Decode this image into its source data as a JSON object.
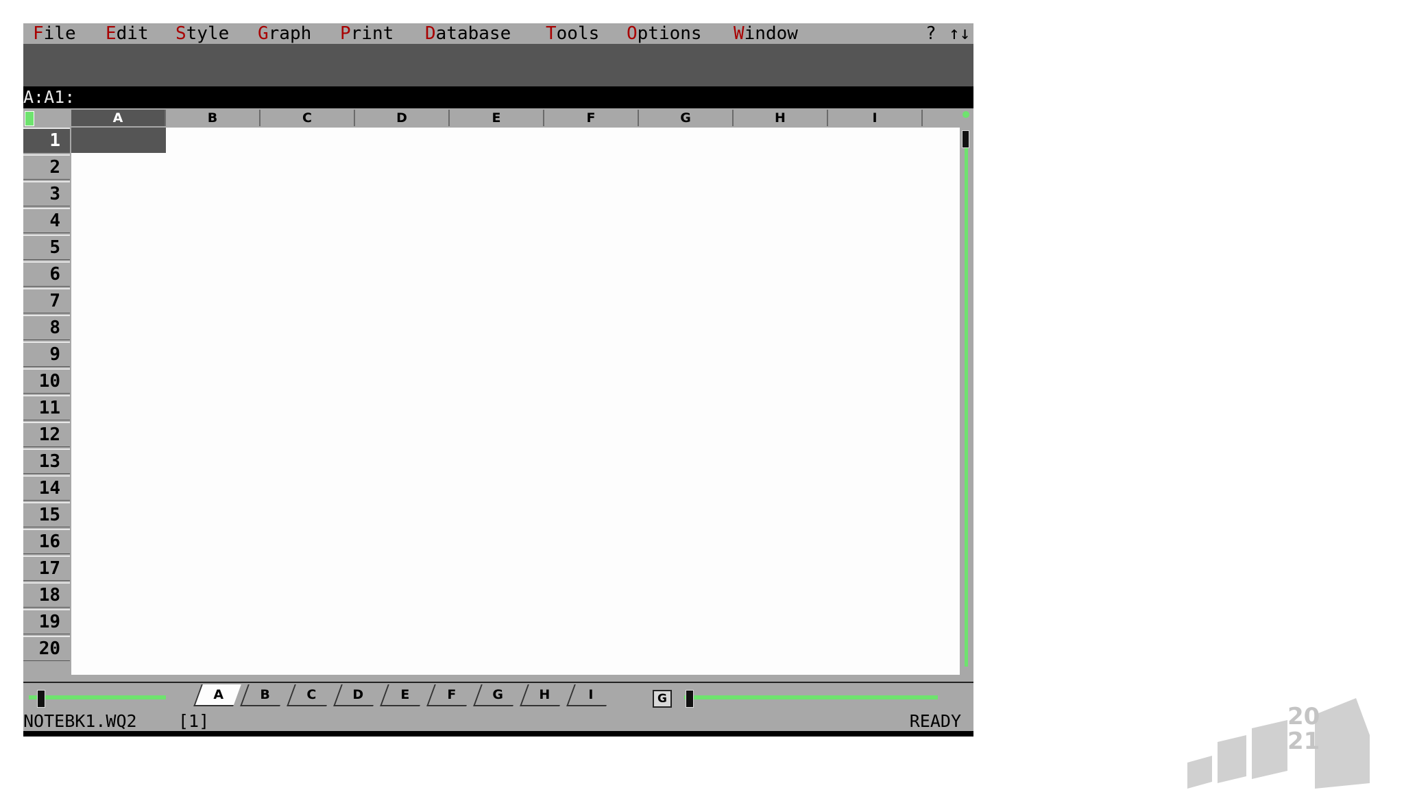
{
  "menu": {
    "items": [
      {
        "hot": "F",
        "rest": "ile"
      },
      {
        "hot": "E",
        "rest": "dit"
      },
      {
        "hot": "S",
        "rest": "tyle"
      },
      {
        "hot": "G",
        "rest": "raph"
      },
      {
        "hot": "P",
        "rest": "rint"
      },
      {
        "hot": "D",
        "rest": "atabase"
      },
      {
        "hot": "T",
        "rest": "ools"
      },
      {
        "hot": "O",
        "rest": "ptions"
      },
      {
        "hot": "W",
        "rest": "indow"
      }
    ],
    "help_label": "?",
    "arrows_label": "↑↓"
  },
  "input_line": {
    "address": "A:A1:"
  },
  "columns": [
    "A",
    "B",
    "C",
    "D",
    "E",
    "F",
    "G",
    "H",
    "I"
  ],
  "rows": [
    "1",
    "2",
    "3",
    "4",
    "5",
    "6",
    "7",
    "8",
    "9",
    "10",
    "11",
    "12",
    "13",
    "14",
    "15",
    "16",
    "17",
    "18",
    "19",
    "20"
  ],
  "sheet_tabs": [
    "A",
    "B",
    "C",
    "D",
    "E",
    "F",
    "G",
    "H",
    "I"
  ],
  "group_button": "G",
  "status": {
    "file": "NOTEBK1.WQ2",
    "window": "[1]",
    "mode": "READY"
  },
  "watermark": {
    "line1": "20",
    "line2": "21"
  },
  "colors": {
    "accent": "#6ee36e",
    "hotkey": "#a80000",
    "chrome": "#a8a8a8",
    "dark": "#555555"
  }
}
